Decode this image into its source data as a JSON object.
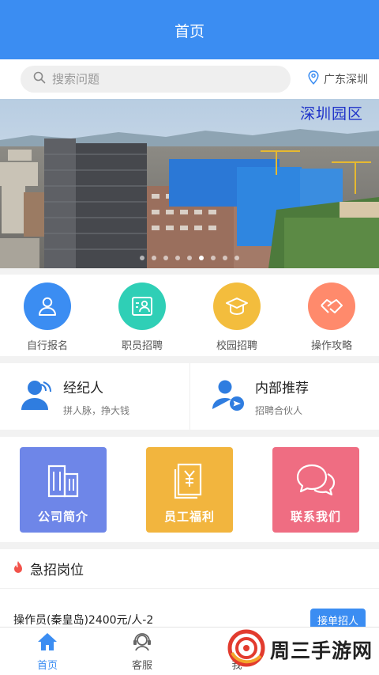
{
  "header": {
    "title": "首页"
  },
  "search": {
    "placeholder": "搜索问题"
  },
  "location": {
    "city": "广东深圳"
  },
  "banner": {
    "caption": "深圳园区",
    "slides": 9,
    "active_slide": 6
  },
  "quick_actions": [
    {
      "label": "自行报名",
      "icon": "person-icon",
      "color": "#3b8df2"
    },
    {
      "label": "职员招聘",
      "icon": "id-card-icon",
      "color": "#2fcfb6"
    },
    {
      "label": "校园招聘",
      "icon": "graduation-cap-icon",
      "color": "#f3bd3d"
    },
    {
      "label": "操作攻略",
      "icon": "handshake-icon",
      "color": "#ff8a6c"
    }
  ],
  "agents": [
    {
      "title": "经纪人",
      "subtitle": "拼人脉，挣大钱"
    },
    {
      "title": "内部推荐",
      "subtitle": "招聘合伙人"
    }
  ],
  "tiles": [
    {
      "label": "公司简介",
      "color": "#6e86e8"
    },
    {
      "label": "员工福利",
      "color": "#f2b53e"
    },
    {
      "label": "联系我们",
      "color": "#ef6d82"
    }
  ],
  "urgent": {
    "title": "急招岗位"
  },
  "jobs": [
    {
      "title": "操作员(秦皇岛)2400元/人-2",
      "action": "接单招人"
    }
  ],
  "tabbar": {
    "items": [
      {
        "label": "首页",
        "active": true
      },
      {
        "label": "客服",
        "active": false
      },
      {
        "label": "我",
        "active": false
      }
    ]
  },
  "watermark": {
    "text": "周三手游网"
  }
}
